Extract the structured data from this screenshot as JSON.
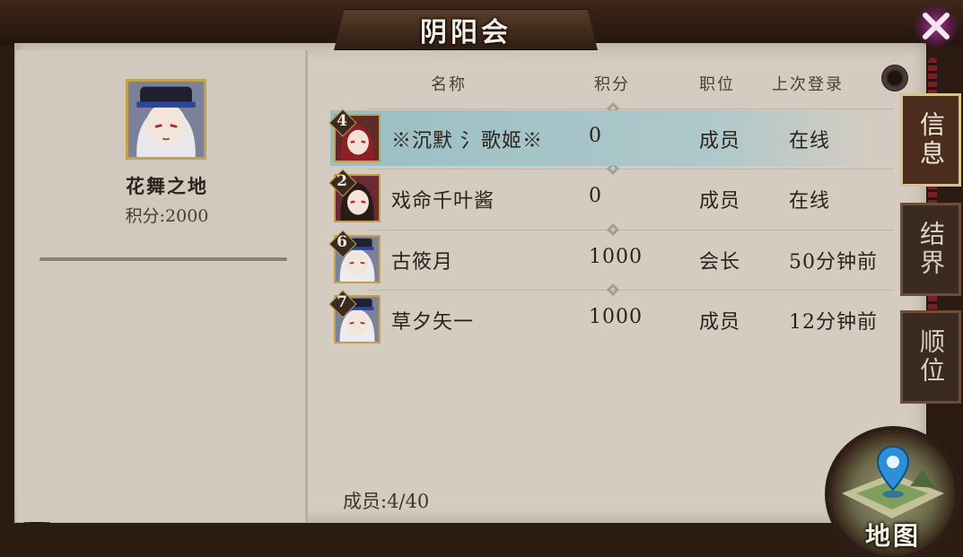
{
  "title": "阴阳会",
  "guild": {
    "name": "花舞之地",
    "score_text": "积分:2000"
  },
  "table": {
    "headers": [
      "名称",
      "积分",
      "职位",
      "上次登录"
    ],
    "rows": [
      {
        "level": "4",
        "name": "※沉默 氵歌姬※",
        "score": "0",
        "role": "成员",
        "last_login": "在线",
        "highlighted": true,
        "avatar": "red-haired-girl-avatar"
      },
      {
        "level": "2",
        "name": "戏命千叶酱",
        "score": "0",
        "role": "成员",
        "last_login": "在线",
        "highlighted": false,
        "avatar": "dark-haired-girl-avatar"
      },
      {
        "level": "6",
        "name": "古筱月",
        "score": "1000",
        "role": "会长",
        "last_login": "50分钟前",
        "highlighted": false,
        "avatar": "white-haired-onmyoji-avatar"
      },
      {
        "level": "7",
        "name": "草夕矢一",
        "score": "1000",
        "role": "成员",
        "last_login": "12分钟前",
        "highlighted": false,
        "avatar": "white-haired-onmyoji-avatar"
      }
    ]
  },
  "members_text": "成员:4/40",
  "tabs": [
    {
      "label": "信息",
      "active": true
    },
    {
      "label": "结界",
      "active": false
    },
    {
      "label": "顺位",
      "active": false
    }
  ],
  "map_button": {
    "label": "地图"
  },
  "colors": {
    "highlight_row": "#9bbfc4",
    "frame_gold": "#c6a04c",
    "board": "#d4ccc1",
    "close_accent": "#a33a8a"
  },
  "icons": [
    "close-icon",
    "map-pin-icon",
    "pushpin-icon",
    "diamond-separator-icon"
  ]
}
